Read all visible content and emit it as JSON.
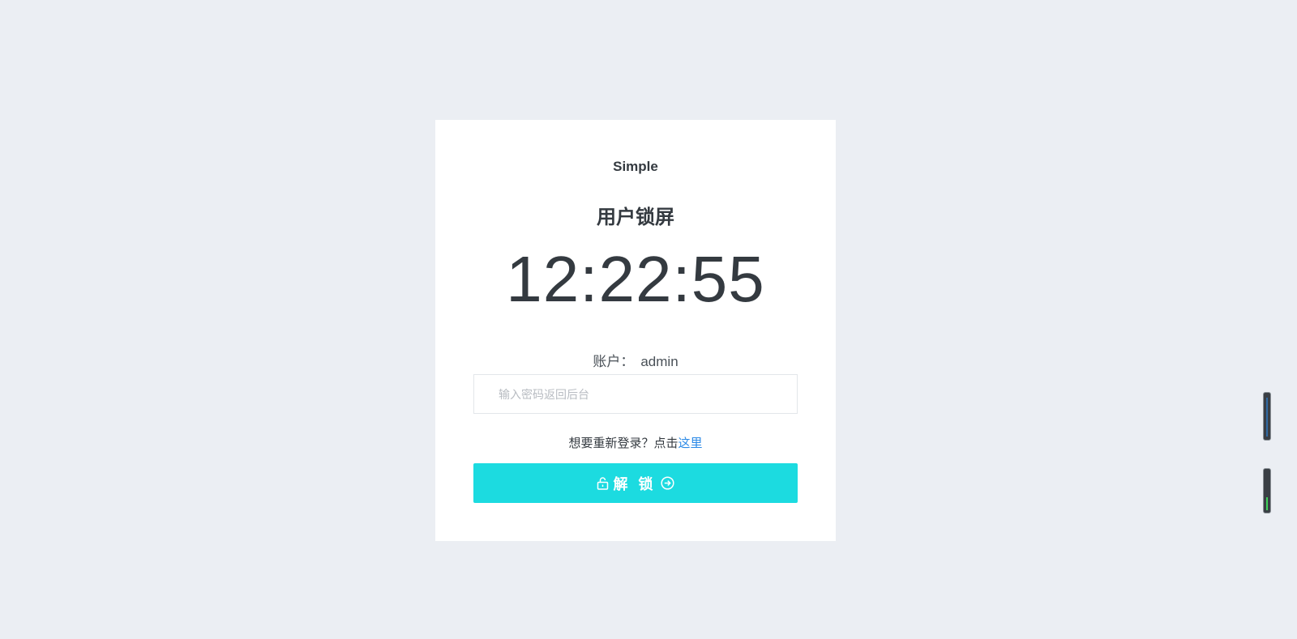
{
  "card": {
    "brand": "Simple",
    "heading": "用户锁屏",
    "clock": "12:22:55",
    "account_label": "账户：",
    "account_value": "admin",
    "password_placeholder": "输入密码返回后台",
    "password_value": "",
    "relogin_prompt": "想要重新登录？点击",
    "relogin_link": "这里",
    "unlock_label": "解 锁"
  },
  "colors": {
    "background": "#ebeef3",
    "card": "#ffffff",
    "unlock_button": "#1cdbe0",
    "link": "#2b89e6"
  },
  "icons": {
    "unlock_leading": "unlock-icon",
    "unlock_trailing": "arrow-circle-right-icon"
  }
}
